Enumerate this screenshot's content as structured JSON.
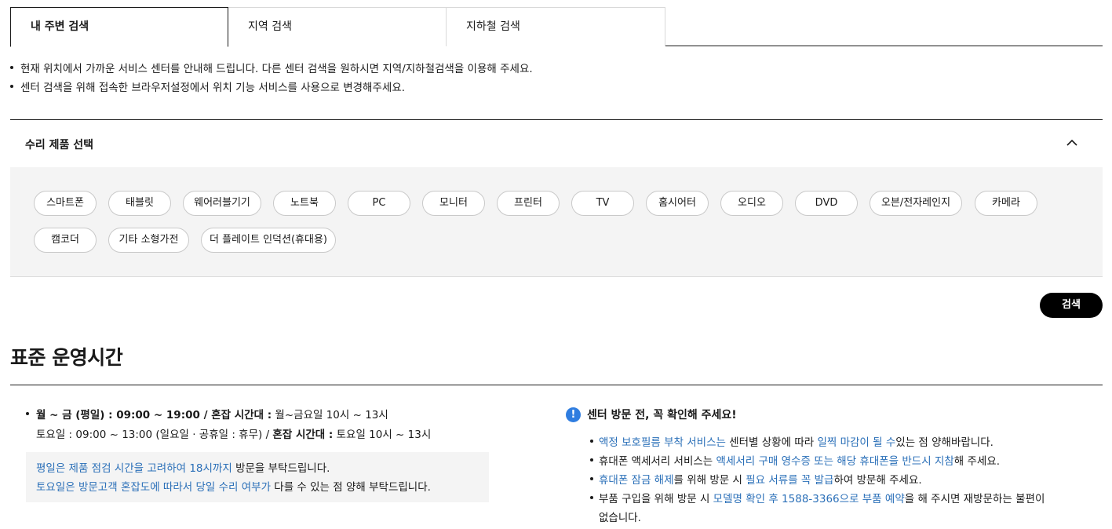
{
  "tabs": [
    {
      "label": "내 주변 검색",
      "active": true
    },
    {
      "label": "지역 검색",
      "active": false
    },
    {
      "label": "지하철 검색",
      "active": false
    }
  ],
  "notices": [
    "현재 위치에서 가까운 서비스 센터를 안내해 드립니다. 다른 센터 검색을 원하시면 지역/지하철검색을 이용해 주세요.",
    "센터 검색을 위해 접속한 브라우저설정에서 위치 기능 서비스를 사용으로 변경해주세요."
  ],
  "product_panel": {
    "title": "수리 제품 선택",
    "products": [
      "스마트폰",
      "태블릿",
      "웨어러블기기",
      "노트북",
      "PC",
      "모니터",
      "프린터",
      "TV",
      "홈시어터",
      "오디오",
      "DVD",
      "오븐/전자레인지",
      "카메라",
      "캠코더",
      "기타 소형가전",
      "더 플레이트 인덕션(휴대용)"
    ]
  },
  "search_button": "검색",
  "hours": {
    "title": "표준 운영시간",
    "weekday_bold": "월 ~ 금 (평일) : 09:00 ~ 19:00 / 혼잡 시간대 :",
    "weekday_rest": " 월~금요일 10시 ~ 13시",
    "saturday_a": "토요일 : 09:00 ~ 13:00 (일요일 · 공휴일 : 휴무) / ",
    "saturday_bold": "혼잡 시간대 :",
    "saturday_rest": " 토요일 10시 ~ 13시",
    "box_line1_blue": "평일은 제품 점검 시간을 고려하여 18시까지",
    "box_line1_rest": " 방문을 부탁드립니다.",
    "box_line2_blue": "토요일은 방문고객 혼잡도에 따라서 당일 수리 여부가",
    "box_line2_rest": " 다를 수 있는 점 양해 부탁드립니다."
  },
  "visit_notice": {
    "icon": "!",
    "title": "센터 방문 전, 꼭 확인해 주세요!",
    "l1a": "액정 보호필름 부착 서비스는",
    "l1b": " 센터별 상황에 따라 ",
    "l1c": "일찍 마감이 될 수",
    "l1d": "있는 점 양해바랍니다.",
    "l2a": "휴대폰 액세서리 서비스는 ",
    "l2b": "액세서리 구매 영수증 또는 해당 휴대폰을 반드시 지참",
    "l2c": "해 주세요.",
    "l3a": "휴대폰 잠금 해제",
    "l3b": "를 위해 방문 시 ",
    "l3c": "필요 서류를 꼭 발급",
    "l3d": "하여 방문해 주세요.",
    "l4a": "부품 구입을 위해 방문 시 ",
    "l4b": "모델명 확인 후 1588-3366으로 부품 예약",
    "l4c": "을 해 주시면 재방문하는 불편이",
    "l4d": "없습니다."
  },
  "colors": {
    "accent_blue": "#2a6fb8",
    "alert_blue": "#2f7de0",
    "button_black": "#000000",
    "panel_bg": "#f4f4f4"
  },
  "icons": {
    "collapse": "chevron-up-icon",
    "alert": "exclamation-circle-icon"
  }
}
